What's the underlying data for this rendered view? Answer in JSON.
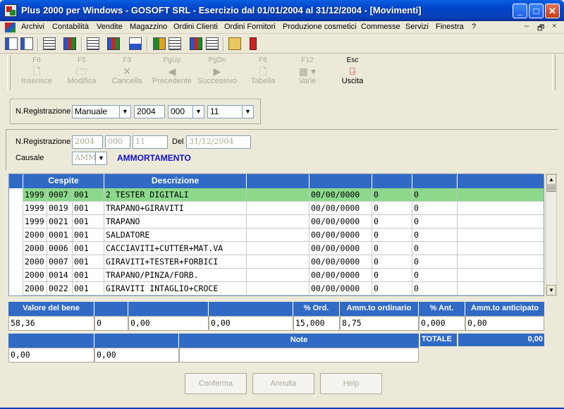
{
  "window": {
    "title": "Plus 2000 per Windows - GOSOFT SRL - Esercizio dal 01/01/2004 al 31/12/2004 - [Movimenti]",
    "minimize": "_",
    "maximize": "□",
    "close": "✕"
  },
  "menu": {
    "items": [
      "Archivi",
      "Contabilità",
      "Vendite",
      "Magazzino",
      "Ordini Clienti",
      "Ordini Fornitori",
      "Produzione cosmetici",
      "Commesse",
      "Servizi",
      "Finestra",
      "?"
    ],
    "mdi_min": "–",
    "mdi_restore": "🗗",
    "mdi_close": "×"
  },
  "toolbar_buttons": [
    {
      "key": "F6",
      "label": "Inserisce",
      "icon": "new-doc-icon",
      "enabled": false
    },
    {
      "key": "F5",
      "label": "Modifica",
      "icon": "folder-icon",
      "enabled": false
    },
    {
      "key": "F3",
      "label": "Cancella",
      "icon": "x-icon",
      "enabled": false
    },
    {
      "key": "PgUp",
      "label": "Precedente",
      "icon": "prev-icon",
      "enabled": false
    },
    {
      "key": "PgDn",
      "label": "Successivo",
      "icon": "next-icon",
      "enabled": false
    },
    {
      "key": "F6",
      "label": "Tabella",
      "icon": "table-icon",
      "enabled": false
    },
    {
      "key": "F12",
      "label": "Varie",
      "icon": "grid-icon",
      "enabled": false
    },
    {
      "key": "Esc",
      "label": "Uscita",
      "icon": "exit-icon",
      "enabled": true
    }
  ],
  "registration": {
    "label": "N.Registrazione",
    "type": "Manuale",
    "year": "2004",
    "series": "000",
    "number": "11"
  },
  "detail": {
    "label": "N.Registrazione",
    "year": "2004",
    "series": "000",
    "number": "11",
    "del_label": "Del",
    "date": "31/12/2004",
    "causale_label": "Causale",
    "causale_code": "AMM",
    "causale_desc": "AMMORTAMENTO"
  },
  "grid": {
    "headers": [
      "Cespite",
      "Descrizione",
      "",
      "",
      "",
      "",
      ""
    ],
    "rows": [
      {
        "anno": "1999",
        "num": "0007",
        "sub": "001",
        "desc": "2 TESTER DIGITALI",
        "c2": "",
        "date": "00/00/0000",
        "c4": "0",
        "c5": "0",
        "selected": true
      },
      {
        "anno": "1999",
        "num": "0019",
        "sub": "001",
        "desc": "TRAPANO+GIRAVITI",
        "c2": "",
        "date": "00/00/0000",
        "c4": "0",
        "c5": "0",
        "selected": false
      },
      {
        "anno": "1999",
        "num": "0021",
        "sub": "001",
        "desc": "TRAPANO",
        "c2": "",
        "date": "00/00/0000",
        "c4": "0",
        "c5": "0",
        "selected": false
      },
      {
        "anno": "2000",
        "num": "0001",
        "sub": "001",
        "desc": "SALDATORE",
        "c2": "",
        "date": "00/00/0000",
        "c4": "0",
        "c5": "0",
        "selected": false
      },
      {
        "anno": "2000",
        "num": "0006",
        "sub": "001",
        "desc": "CACCIAVITI+CUTTER+MAT.VA",
        "c2": "",
        "date": "00/00/0000",
        "c4": "0",
        "c5": "0",
        "selected": false
      },
      {
        "anno": "2000",
        "num": "0007",
        "sub": "001",
        "desc": "GIRAVITI+TESTER+FORBICI",
        "c2": "",
        "date": "00/00/0000",
        "c4": "0",
        "c5": "0",
        "selected": false
      },
      {
        "anno": "2000",
        "num": "0014",
        "sub": "001",
        "desc": "TRAPANO/PINZA/FORB.",
        "c2": "",
        "date": "00/00/0000",
        "c4": "0",
        "c5": "0",
        "selected": false
      },
      {
        "anno": "2000",
        "num": "0022",
        "sub": "001",
        "desc": "GIRAVITI INTAGLIO+CROCE",
        "c2": "",
        "date": "00/00/0000",
        "c4": "0",
        "c5": "0",
        "selected": false
      }
    ]
  },
  "values_table": {
    "headers": [
      "Valore del bene",
      "",
      "",
      "",
      "% Ord.",
      "Amm.to ordinario",
      "% Ant.",
      "Amm.to anticipato"
    ],
    "values": [
      "58,36",
      "0",
      "0,00",
      "0,00",
      "15,000",
      "8,75",
      "0,000",
      "0,00"
    ]
  },
  "notes_table": {
    "headers": [
      "",
      "",
      "Note"
    ],
    "values": [
      "0,00",
      "0,00",
      ""
    ]
  },
  "totale": {
    "label": "TOTALE",
    "value": "0,00"
  },
  "buttons": {
    "confirm": "Conferma",
    "cancel": "Annulla",
    "help": "Help"
  },
  "colors": {
    "header_blue": "#316ac5",
    "selected_row": "#8cd98c",
    "causale_blue": "#1010c0"
  }
}
